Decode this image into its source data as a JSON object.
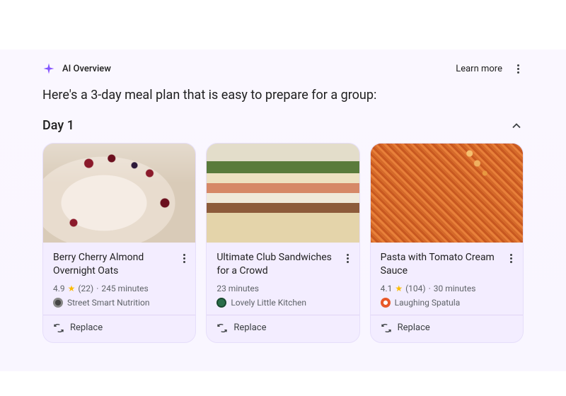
{
  "header": {
    "ai_label": "AI Overview",
    "learn_more": "Learn more"
  },
  "intro": "Here's a 3-day meal plan that is easy to prepare for a group:",
  "day": {
    "title": "Day 1"
  },
  "cards": [
    {
      "title": "Berry Cherry Almond Overnight Oats",
      "rating": "4.9",
      "reviews": "(22)",
      "sep": "·",
      "time": "245 minutes",
      "source": "Street Smart Nutrition",
      "replace": "Replace"
    },
    {
      "title": "Ultimate Club Sandwiches for a Crowd",
      "time": "23 minutes",
      "source": "Lovely Little Kitchen",
      "replace": "Replace"
    },
    {
      "title": "Pasta with Tomato Cream Sauce",
      "rating": "4.1",
      "reviews": "(104)",
      "sep": "·",
      "time": "30 minutes",
      "source": "Laughing Spatula",
      "replace": "Replace"
    }
  ]
}
